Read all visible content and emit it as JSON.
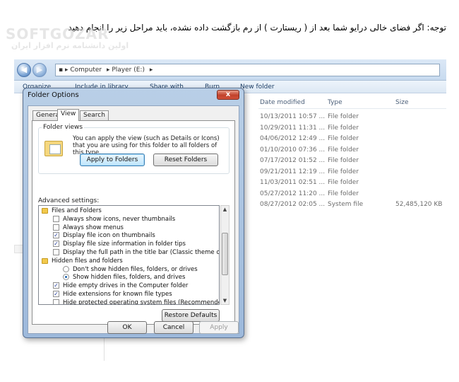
{
  "note": "توجه: اگر فضای خالی درایو شما بعد از ( ریستارت ) از رم بازگشت داده نشده، باید مراحل زیر را انجام دهید",
  "watermark": {
    "brand": "SOFTGOZAR",
    "tagline": "اولین دانشنامه نرم افزار ایران"
  },
  "explorer": {
    "breadcrumb": [
      "Computer",
      "Player (E:)"
    ],
    "toolbar": [
      "Organize",
      "Include in library",
      "Share with",
      "Burn",
      "New folder"
    ],
    "columns": [
      "Date modified",
      "Type",
      "Size"
    ],
    "files": [
      {
        "date": "10/13/2011 10:57 ...",
        "type": "File folder",
        "size": ""
      },
      {
        "date": "10/29/2011 11:31 ...",
        "type": "File folder",
        "size": ""
      },
      {
        "date": "04/06/2012 12:49 ...",
        "type": "File folder",
        "size": ""
      },
      {
        "date": "01/10/2010 07:36 ...",
        "type": "File folder",
        "size": ""
      },
      {
        "date": "07/17/2012 01:52 ...",
        "type": "File folder",
        "size": ""
      },
      {
        "date": "09/21/2011 12:19 ...",
        "type": "File folder",
        "size": ""
      },
      {
        "date": "11/03/2011 02:51 ...",
        "type": "File folder",
        "size": ""
      },
      {
        "date": "05/27/2012 11:20 ...",
        "type": "File folder",
        "size": ""
      },
      {
        "date": "08/27/2012 02:05 ...",
        "type": "System file",
        "size": "52,485,120 KB"
      }
    ]
  },
  "dialog": {
    "title": "Folder Options",
    "close": "x",
    "tabs": [
      "General",
      "View",
      "Search"
    ],
    "folder_views": {
      "label": "Folder views",
      "description": "You can apply the view (such as Details or Icons) that you are using for this folder to all folders of this type.",
      "apply": "Apply to Folders",
      "reset": "Reset Folders"
    },
    "advanced_label": "Advanced settings:",
    "advanced": [
      {
        "kind": "folder",
        "label": "Files and Folders"
      },
      {
        "kind": "check",
        "checked": "",
        "label": "Always show icons, never thumbnails"
      },
      {
        "kind": "check",
        "checked": "",
        "label": "Always show menus"
      },
      {
        "kind": "check",
        "checked": "✓",
        "label": "Display file icon on thumbnails"
      },
      {
        "kind": "check",
        "checked": "✓",
        "label": "Display file size information in folder tips"
      },
      {
        "kind": "check",
        "checked": "",
        "label": "Display the full path in the title bar (Classic theme only)"
      },
      {
        "kind": "folder",
        "label": "Hidden files and folders"
      },
      {
        "kind": "radio",
        "checked": false,
        "label": "Don't show hidden files, folders, or drives"
      },
      {
        "kind": "radio",
        "checked": true,
        "label": "Show hidden files, folders, and drives"
      },
      {
        "kind": "check",
        "checked": "✓",
        "label": "Hide empty drives in the Computer folder"
      },
      {
        "kind": "check",
        "checked": "✓",
        "label": "Hide extensions for known file types"
      },
      {
        "kind": "check",
        "checked": "",
        "label": "Hide protected operating system files (Recommended)"
      }
    ],
    "restore": "Restore Defaults",
    "ok": "OK",
    "cancel": "Cancel",
    "apply": "Apply"
  }
}
